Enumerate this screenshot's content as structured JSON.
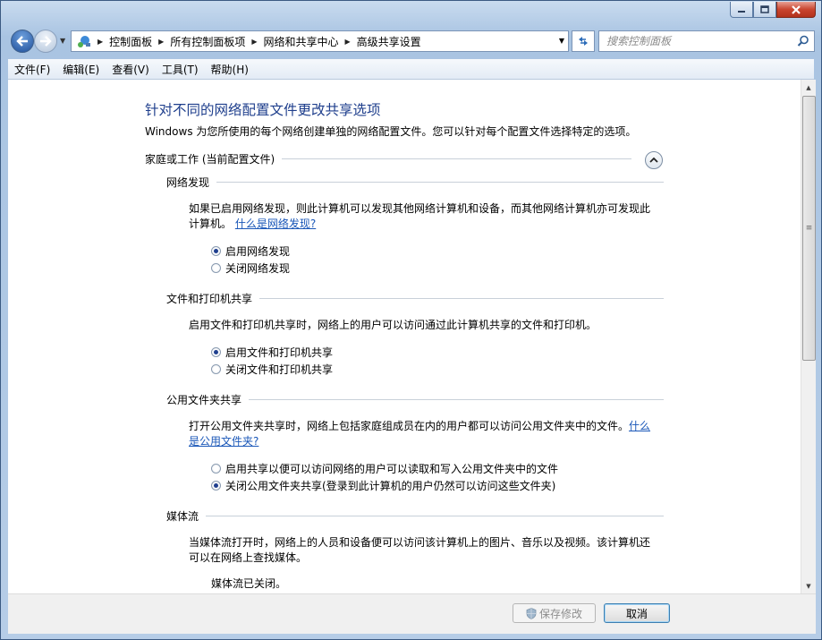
{
  "window": {
    "controls": {
      "minimize": "minimize-icon",
      "maximize": "maximize-icon",
      "close": "close-icon"
    }
  },
  "address_bar": {
    "icon": "network-icon",
    "breadcrumbs": [
      "控制面板",
      "所有控制面板项",
      "网络和共享中心",
      "高级共享设置"
    ]
  },
  "search": {
    "placeholder": "搜索控制面板"
  },
  "menu": [
    "文件(F)",
    "编辑(E)",
    "查看(V)",
    "工具(T)",
    "帮助(H)"
  ],
  "page": {
    "title": "针对不同的网络配置文件更改共享选项",
    "description": "Windows 为您所使用的每个网络创建单独的网络配置文件。您可以针对每个配置文件选择特定的选项。",
    "profile_header": "家庭或工作 (当前配置文件)",
    "sections": {
      "discovery": {
        "title": "网络发现",
        "text_line1": "如果已启用网络发现，则此计算机可以发现其他网络计算机和设备，而其他网络计算机亦可发现此",
        "text_line2_pre": "计算机。",
        "link": "什么是网络发现?",
        "options": [
          {
            "label": "启用网络发现",
            "selected": true
          },
          {
            "label": "关闭网络发现",
            "selected": false
          }
        ]
      },
      "file_printer": {
        "title": "文件和打印机共享",
        "text": "启用文件和打印机共享时，网络上的用户可以访问通过此计算机共享的文件和打印机。",
        "options": [
          {
            "label": "启用文件和打印机共享",
            "selected": true
          },
          {
            "label": "关闭文件和打印机共享",
            "selected": false
          }
        ]
      },
      "public_folder": {
        "title": "公用文件夹共享",
        "text_line1": "打开公用文件夹共享时，网络上包括家庭组成员在内的用户都可以访问公用文件夹中的文件。",
        "link_part1": "什么",
        "link_part2": "是公用文件夹?",
        "options": [
          {
            "label": "启用共享以便可以访问网络的用户可以读取和写入公用文件夹中的文件",
            "selected": false
          },
          {
            "label": "关闭公用文件夹共享(登录到此计算机的用户仍然可以访问这些文件夹)",
            "selected": true
          }
        ]
      },
      "media": {
        "title": "媒体流",
        "text_line1": "当媒体流打开时，网络上的人员和设备便可以访问该计算机上的图片、音乐以及视频。该计算机还",
        "text_line2": "可以在网络上查找媒体。",
        "status": "媒体流已关闭。"
      }
    }
  },
  "footer": {
    "save_label": "保存修改",
    "save_icon": "uac-shield-icon",
    "cancel_label": "取消"
  }
}
